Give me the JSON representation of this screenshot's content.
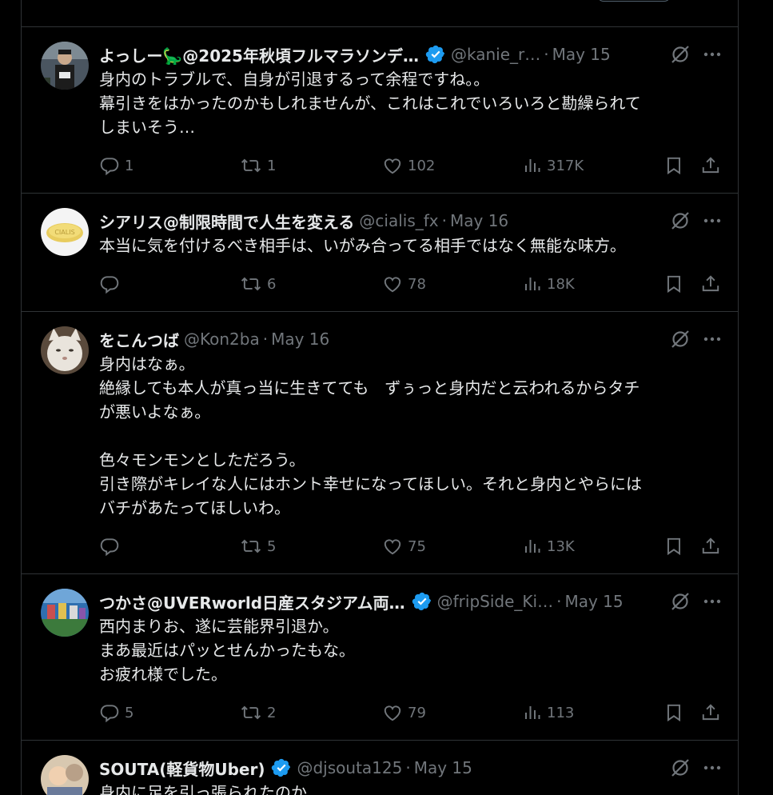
{
  "tweets": [
    {
      "name": "よっしー🦕@2025年秋頃フルマラソンデ…",
      "verified": true,
      "handle": "@kanie_r…",
      "date": "May 15",
      "text": "身内のトラブルで、自身が引退するって余程ですね。。\n幕引きをはかったのかもしれませんが、これはこれでいろいろと勘繰られて\nしまいそう…",
      "replies": "1",
      "reposts": "1",
      "likes": "102",
      "views": "317K"
    },
    {
      "name": "シアリス@制限時間で人生を変える",
      "verified": false,
      "handle": "@cialis_fx",
      "date": "May 16",
      "text": "本当に気を付けるべき相手は、いがみ合ってる相手ではなく無能な味方。",
      "replies": "",
      "reposts": "6",
      "likes": "78",
      "views": "18K"
    },
    {
      "name": "をこんつば",
      "verified": false,
      "handle": "@Kon2ba",
      "date": "May 16",
      "text": "身内はなぁ。\n絶縁しても本人が真っ当に生きてても　ずぅっと身内だと云われるからタチ\nが悪いよなぁ。\n\n色々モンモンとしただろう。\n引き際がキレイな人にはホント幸せになってほしい。それと身内とやらには\nバチがあたってほしいわ。",
      "replies": "",
      "reposts": "5",
      "likes": "75",
      "views": "13K"
    },
    {
      "name": "つかさ@UVERworld日産スタジアム両…",
      "verified": true,
      "handle": "@fripSide_Ki…",
      "date": "May 15",
      "text": "西内まりお、遂に芸能界引退か。\nまあ最近はパッとせんかったもな。\nお疲れ様でした。",
      "replies": "5",
      "reposts": "2",
      "likes": "79",
      "views": "113"
    },
    {
      "name": "SOUTA(軽貨物Uber)",
      "verified": true,
      "handle": "@djsouta125",
      "date": "May 15",
      "text": "身内に足を引っ張られたのか"
    }
  ],
  "colors": {
    "background": "#000000",
    "text": "#e7e9ea",
    "secondary": "#71767b",
    "border": "#2f3336",
    "verified": "#1d9bf0"
  },
  "icons": [
    "verified-badge-icon",
    "grok-icon",
    "more-icon",
    "reply-icon",
    "repost-icon",
    "like-icon",
    "views-icon",
    "bookmark-icon",
    "share-icon"
  ]
}
